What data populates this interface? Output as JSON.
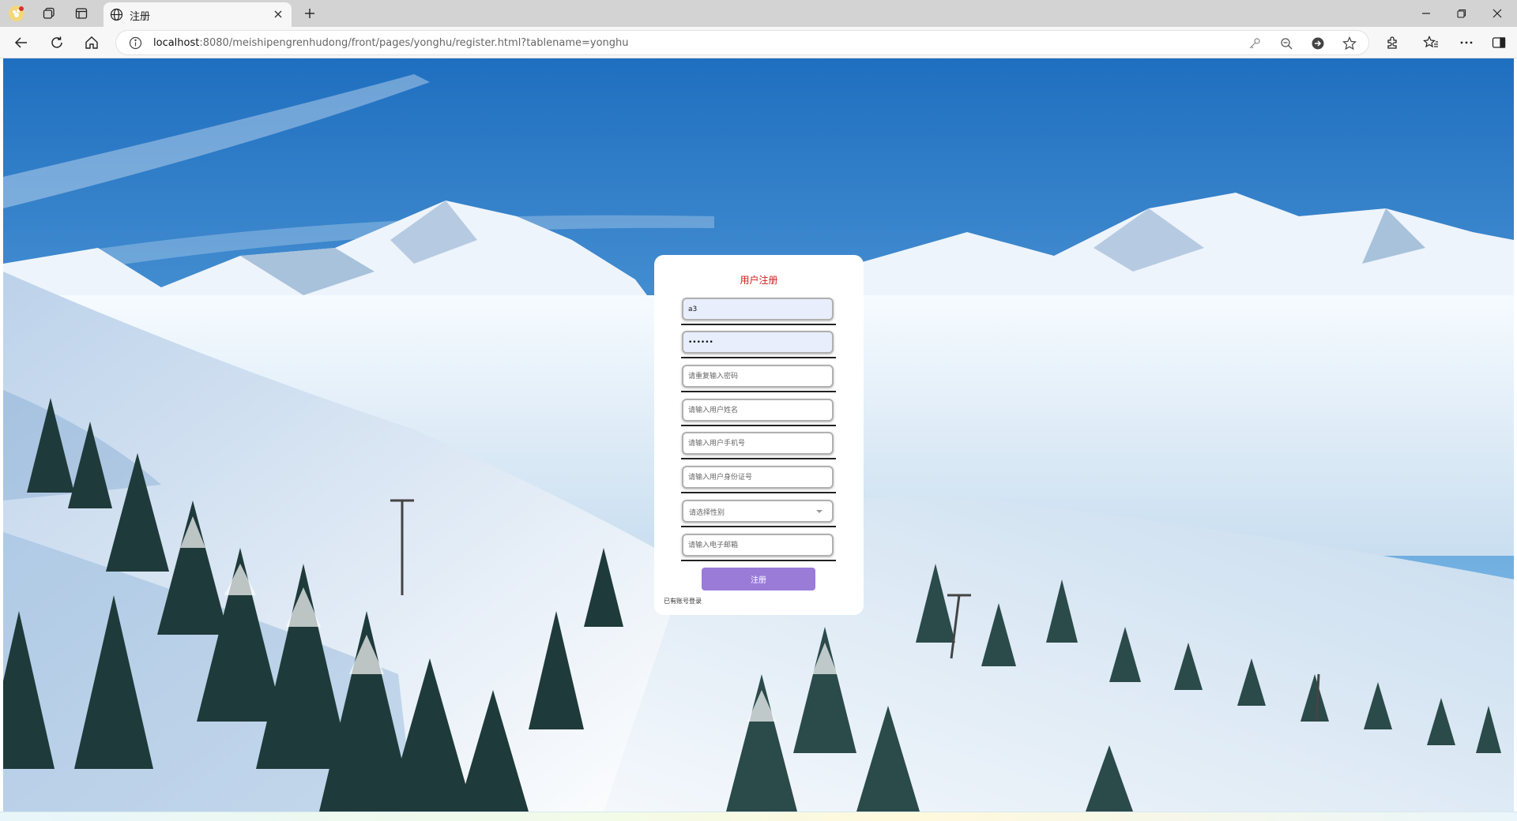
{
  "browser": {
    "tab": {
      "title": "注册"
    },
    "url": {
      "host": "localhost",
      "rest": ":8080/meishipengrenhudong/front/pages/yonghu/register.html?tablename=yonghu"
    }
  },
  "form": {
    "title": "用户注册",
    "fields": [
      {
        "value": "a3",
        "placeholder": ""
      },
      {
        "value": "••••••",
        "placeholder": ""
      },
      {
        "value": "",
        "placeholder": "请重复输入密码"
      },
      {
        "value": "",
        "placeholder": "请输入用户姓名"
      },
      {
        "value": "",
        "placeholder": "请输入用户手机号"
      },
      {
        "value": "",
        "placeholder": "请输入用户身份证号"
      },
      {
        "value": "",
        "placeholder": "请选择性别"
      },
      {
        "value": "",
        "placeholder": "请输入电子邮箱"
      }
    ],
    "submit_label": "注册",
    "login_link": "已有账号登录"
  }
}
